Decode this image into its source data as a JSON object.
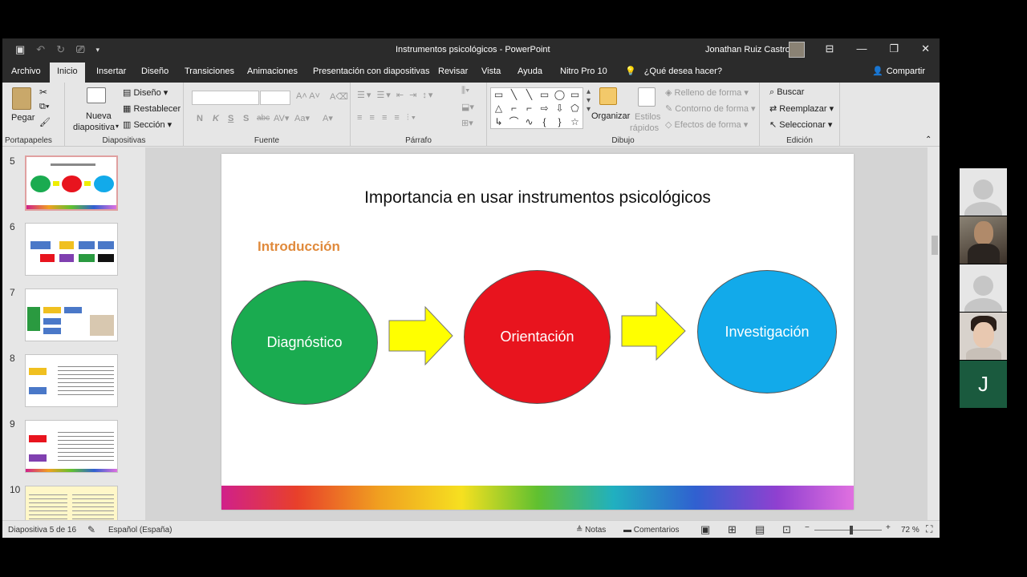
{
  "window": {
    "title": "Instrumentos psicológicos  -  PowerPoint",
    "user": "Jonathan Ruiz Castro"
  },
  "tabs": [
    "Archivo",
    "Inicio",
    "Insertar",
    "Diseño",
    "Transiciones",
    "Animaciones",
    "Presentación con diapositivas",
    "Revisar",
    "Vista",
    "Ayuda",
    "Nitro Pro 10"
  ],
  "active_tab": "Inicio",
  "tell_me": "¿Qué desea hacer?",
  "share": "Compartir",
  "ribbon": {
    "portapapeles": {
      "label": "Portapapeles",
      "paste": "Pegar"
    },
    "diapositivas": {
      "label": "Diapositivas",
      "nueva": "Nueva",
      "diapositiva": "diapositiva",
      "diseno": "Diseño",
      "restablecer": "Restablecer",
      "seccion": "Sección"
    },
    "fuente": {
      "label": "Fuente",
      "bold": "N",
      "italic": "K",
      "underline": "S",
      "shadow": "S",
      "strike": "abc"
    },
    "parrafo": {
      "label": "Párrafo"
    },
    "dibujo": {
      "label": "Dibujo",
      "organizar": "Organizar",
      "estilos": "Estilos",
      "rapidos": "rápidos",
      "relleno": "Relleno de forma",
      "contorno": "Contorno de forma",
      "efectos": "Efectos de forma"
    },
    "edicion": {
      "label": "Edición",
      "buscar": "Buscar",
      "reemplazar": "Reemplazar",
      "seleccionar": "Seleccionar"
    }
  },
  "thumbnails": [
    "5",
    "6",
    "7",
    "8",
    "9",
    "10"
  ],
  "slide": {
    "title": "Importancia en usar instrumentos psicológicos",
    "subtitle": "Introducción",
    "steps": [
      "Diagnóstico",
      "Orientación",
      "Investigación"
    ]
  },
  "status": {
    "slide_of": "Diapositiva 5 de 16",
    "language": "Español (España)",
    "notes": "Notas",
    "comments": "Comentarios",
    "zoom": "72 %",
    "zoom_fraction": 0.55
  },
  "participants": {
    "initial": "J"
  },
  "colors": {
    "green": "#1aab50",
    "red": "#e8141e",
    "blue": "#12aaea",
    "arrow": "#ffff00",
    "accent": "#e08a3c"
  }
}
